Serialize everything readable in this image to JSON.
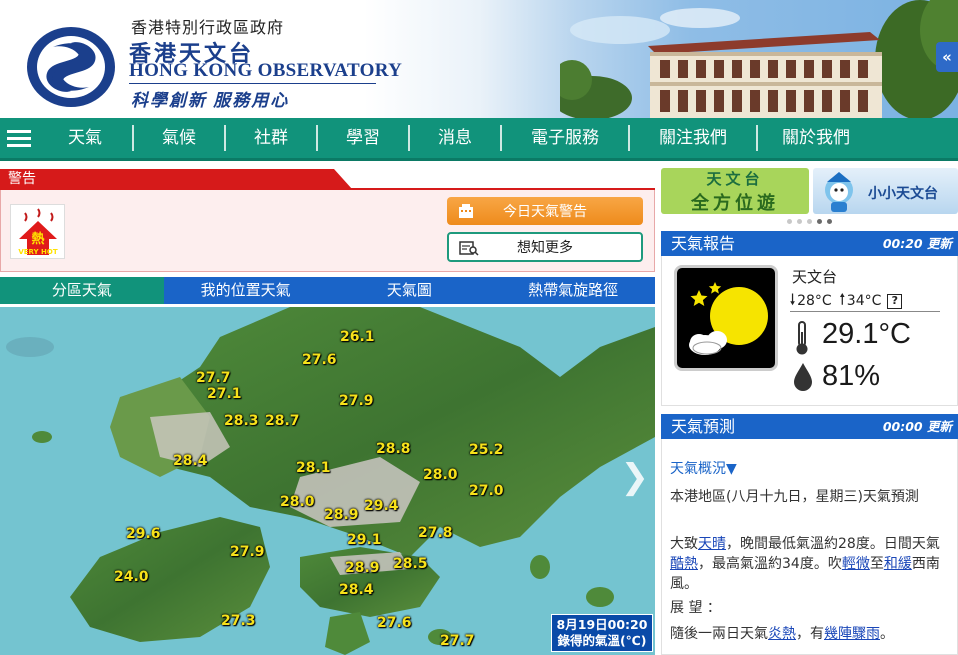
{
  "header": {
    "gov_line": "香港特別行政區政府",
    "hko_zh": "香港天文台",
    "hko_en": "HONG KONG OBSERVATORY",
    "slogan": "科學創新 服務用心",
    "collapse_label": "«"
  },
  "nav": {
    "items": [
      "天氣",
      "氣候",
      "社群",
      "學習",
      "消息",
      "電子服務",
      "關注我們",
      "關於我們"
    ]
  },
  "warnings": {
    "tab_label": "警告",
    "icon_text_top": "熱",
    "icon_text_bottom": "VERY HOT",
    "today_button": "今日天氣警告",
    "more_button": "想知更多"
  },
  "map_tabs": [
    "分區天氣",
    "我的位置天氣",
    "天氣圖",
    "熱帶氣旋路徑"
  ],
  "map": {
    "caption_line1": "8月19日00:20",
    "caption_line2": "錄得的氣溫(℃)",
    "temperatures": [
      "26.1",
      "27.6",
      "27.7",
      "27.1",
      "27.9",
      "28.3",
      "28.7",
      "28.8",
      "25.2",
      "28.4",
      "28.1",
      "28.0",
      "27.0",
      "28.0",
      "29.4",
      "28.9",
      "29.6",
      "29.1",
      "27.8",
      "27.9",
      "24.0",
      "28.9",
      "28.5",
      "28.4",
      "27.3",
      "27.6",
      "27.7"
    ]
  },
  "promos": {
    "promo1_line1": "天文台",
    "promo1_line2": "全方位遊",
    "promo2": "小小天文台"
  },
  "report": {
    "title": "天氣報告",
    "updated": "00:20 更新",
    "station": "天文台",
    "min_temp": "28°C",
    "max_temp": "34°C",
    "temperature": "29.1°C",
    "humidity": "81%"
  },
  "forecast": {
    "title": "天氣預測",
    "updated": "00:00 更新",
    "summary_link": "天氣概況▼",
    "para1": "本港地區(八月十九日，星期三)天氣預測",
    "p2_a": "大致",
    "p2_link1": "天晴",
    "p2_b": "，晚間最低氣溫約28度。日間天氣",
    "p2_link2": "酷熱",
    "p2_c": "，最高氣溫約34度。吹",
    "p2_link3": "輕微",
    "p2_d": "至",
    "p2_link4": "和緩",
    "p2_e": "西南風。",
    "outlook_label": "展 望 ：",
    "p3_a": "隨後一兩日天氣",
    "p3_link1": "炎熱",
    "p3_b": "，有",
    "p3_link2": "幾陣驟雨",
    "p3_c": "。"
  },
  "colors": {
    "nav_green": "#11937b",
    "tab_blue": "#1a64c8",
    "warning_red": "#d61a1a",
    "temp_yellow": "#f7e21a"
  }
}
